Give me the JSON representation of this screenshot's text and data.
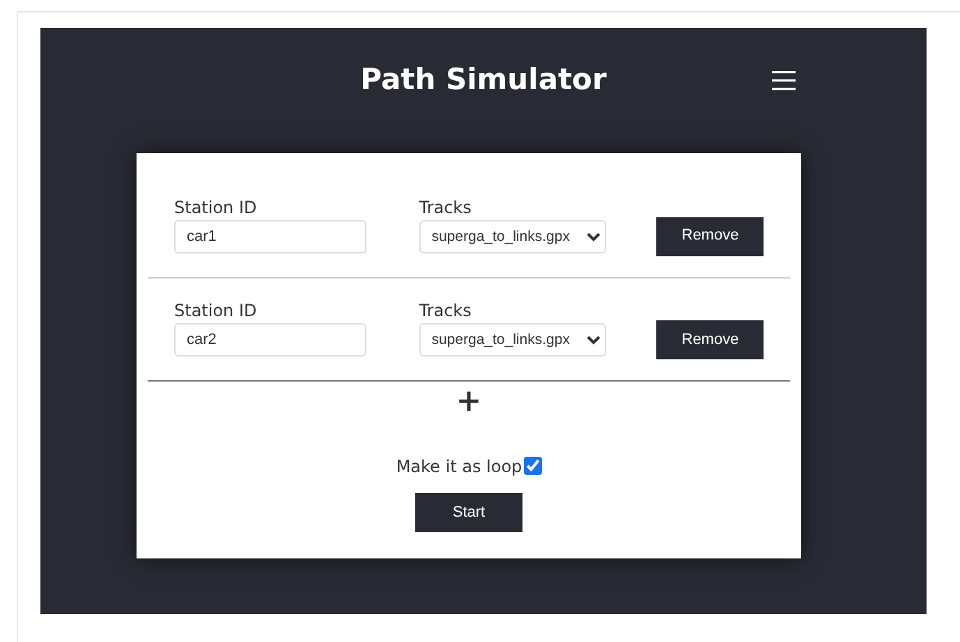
{
  "header": {
    "title": "Path Simulator"
  },
  "stations": [
    {
      "id_label": "Station ID",
      "id_value": "car1",
      "tracks_label": "Tracks",
      "track": "superga_to_links.gpx",
      "remove": "Remove"
    },
    {
      "id_label": "Station ID",
      "id_value": "car2",
      "tracks_label": "Tracks",
      "track": "superga_to_links.gpx",
      "remove": "Remove"
    }
  ],
  "add_button": "+",
  "loop": {
    "label": "Make it as loop",
    "checked": true
  },
  "start_button": "Start"
}
